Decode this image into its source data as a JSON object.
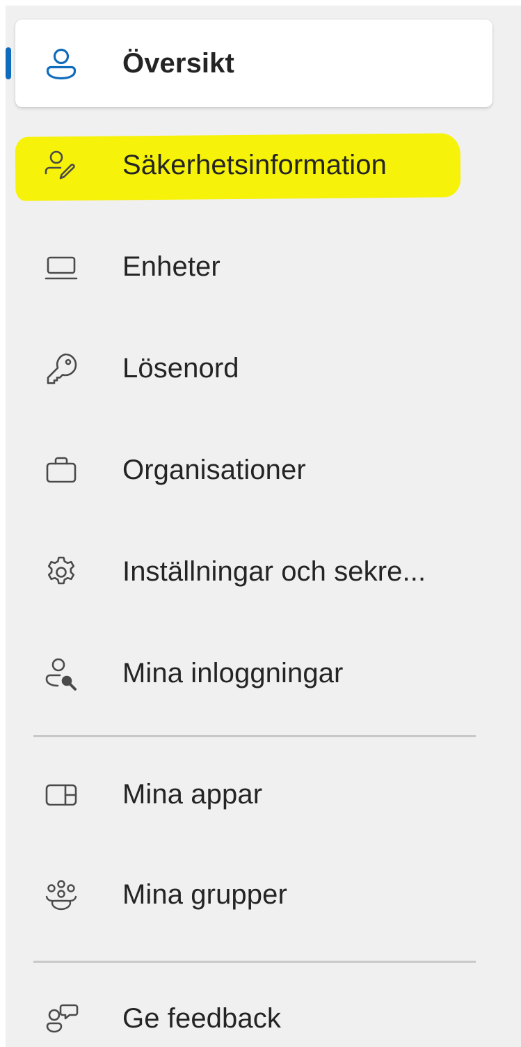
{
  "accent_color": "#0f6cbd",
  "highlight_color": "#f6f20a",
  "nav": {
    "items": [
      {
        "label": "Översikt",
        "icon": "person-icon",
        "selected": true
      },
      {
        "label": "Säkerhetsinformation",
        "icon": "person-edit-icon",
        "highlighted": true
      },
      {
        "label": "Enheter",
        "icon": "laptop-icon"
      },
      {
        "label": "Lösenord",
        "icon": "key-icon"
      },
      {
        "label": "Organisationer",
        "icon": "briefcase-icon"
      },
      {
        "label": "Inställningar och sekre...",
        "icon": "gear-icon"
      },
      {
        "label": "Mina inloggningar",
        "icon": "person-key-icon"
      }
    ],
    "secondary_items": [
      {
        "label": "Mina appar",
        "icon": "apps-icon"
      },
      {
        "label": "Mina grupper",
        "icon": "people-community-icon"
      }
    ],
    "footer_items": [
      {
        "label": "Ge feedback",
        "icon": "person-feedback-icon"
      }
    ]
  }
}
